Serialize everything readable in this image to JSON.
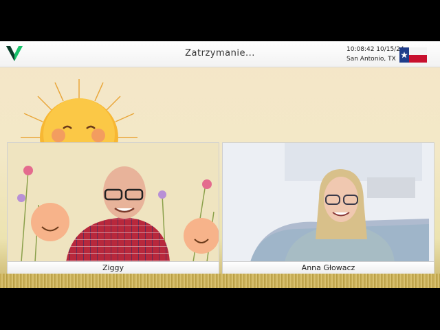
{
  "header": {
    "title": "Zatrzymanie...",
    "time_date": "10:08:42 10/15/24",
    "location": "San Antonio, TX",
    "flag_icon": "texas-flag-icon",
    "logo_icon": "green-v-logo-icon"
  },
  "participants": [
    {
      "name": "Ziggy"
    },
    {
      "name": "Anna Głowacz"
    }
  ],
  "colors": {
    "logo_green": "#17c36a",
    "logo_dark": "#0b3b2a",
    "sun": "#f7b733"
  }
}
